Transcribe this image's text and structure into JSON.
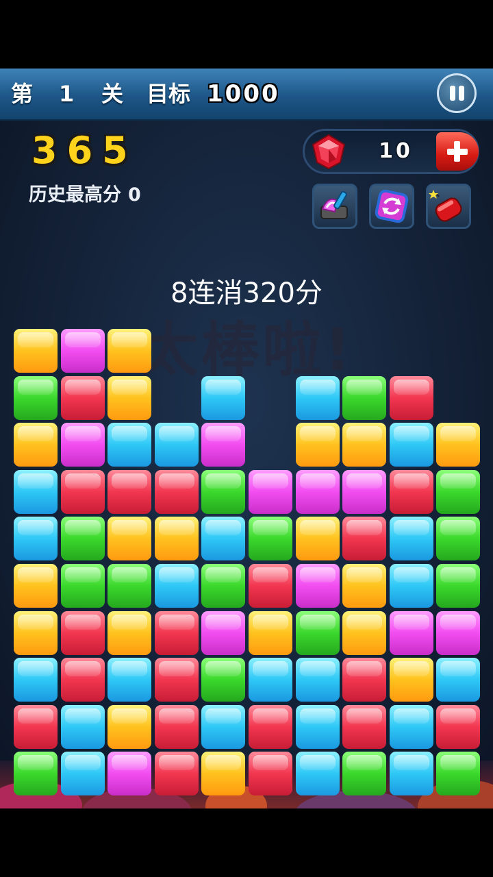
{
  "level": {
    "prefix": "第",
    "number": "1",
    "suffix": "关",
    "target_label": "目标",
    "target_value": "1000"
  },
  "score": "365",
  "best": {
    "label": "历史最高分",
    "value": "0"
  },
  "gems": {
    "count": "10"
  },
  "tools": [
    {
      "name": "paint-brush-icon"
    },
    {
      "name": "shuffle-icon"
    },
    {
      "name": "bomb-icon"
    }
  ],
  "combo_text": "8连消320分",
  "praise_text": "太棒啦!",
  "colors": {
    "yellow": "#ffc21e",
    "pink": "#f24df0",
    "green": "#3bd82c",
    "red": "#f23650",
    "blue": "#2ec8f6",
    "header": "#1d5687",
    "score": "#ffd21c"
  },
  "board": [
    [
      "yellow",
      "pink",
      "yellow",
      null,
      null,
      null,
      null,
      null,
      null,
      null
    ],
    [
      "green",
      "red",
      "yellow",
      null,
      "blue",
      null,
      "blue",
      "green",
      "red",
      null
    ],
    [
      "yellow",
      "pink",
      "blue",
      "blue",
      "pink",
      null,
      "yellow",
      "yellow",
      "blue",
      "yellow"
    ],
    [
      "blue",
      "red",
      "red",
      "red",
      "green",
      "pink",
      "pink",
      "pink",
      "red",
      "green"
    ],
    [
      "blue",
      "green",
      "yellow",
      "yellow",
      "blue",
      "green",
      "yellow",
      "red",
      "blue",
      "green"
    ],
    [
      "yellow",
      "green",
      "green",
      "blue",
      "green",
      "red",
      "pink",
      "yellow",
      "blue",
      "green"
    ],
    [
      "yellow",
      "red",
      "yellow",
      "red",
      "pink",
      "yellow",
      "green",
      "yellow",
      "pink",
      "pink"
    ],
    [
      "blue",
      "red",
      "blue",
      "red",
      "green",
      "blue",
      "blue",
      "red",
      "yellow",
      "blue"
    ],
    [
      "red",
      "blue",
      "yellow",
      "red",
      "blue",
      "red",
      "blue",
      "red",
      "blue",
      "red"
    ],
    [
      "green",
      "blue",
      "pink",
      "red",
      "yellow",
      "red",
      "blue",
      "green",
      "blue",
      "green"
    ]
  ]
}
